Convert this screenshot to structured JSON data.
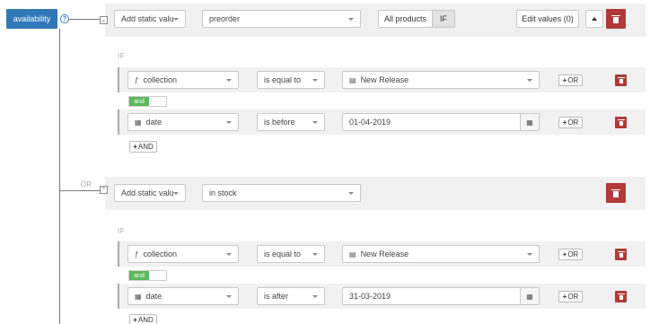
{
  "availability_label": "availability",
  "help_icon": "?",
  "blocks": [
    {
      "toggle": "chevron-down",
      "value_source": "Add static valu",
      "value": "preorder",
      "all_products_label": "All products",
      "if_label": "IF",
      "edit_values_label": "Edit values (0)",
      "conditions_label": "IF",
      "conditions": [
        {
          "field": "collection",
          "field_icon": "function-icon",
          "operator": "is equal to",
          "value": "New Release",
          "value_icon": "tag-icon",
          "or_label": "OR"
        },
        {
          "field": "date",
          "field_icon": "calendar-icon",
          "operator": "is before",
          "value": "01-04-2019",
          "or_label": "OR"
        }
      ],
      "and_label": "and",
      "add_and_label": "AND"
    },
    {
      "toggle": "chevron-up",
      "value_source": "Add static valu",
      "value": "in stock",
      "conditions_label": "IF",
      "conditions": [
        {
          "field": "collection",
          "field_icon": "function-icon",
          "operator": "is equal to",
          "value": "New Release",
          "value_icon": "tag-icon",
          "or_label": "OR"
        },
        {
          "field": "date",
          "field_icon": "calendar-icon",
          "operator": "is after",
          "value": "31-03-2019",
          "or_label": "OR"
        }
      ],
      "and_label": "and",
      "add_and_label": "AND"
    }
  ],
  "or_separator": "OR",
  "colors": {
    "primary": "#3278b6",
    "danger": "#b0393a",
    "success": "#5cb85c"
  }
}
